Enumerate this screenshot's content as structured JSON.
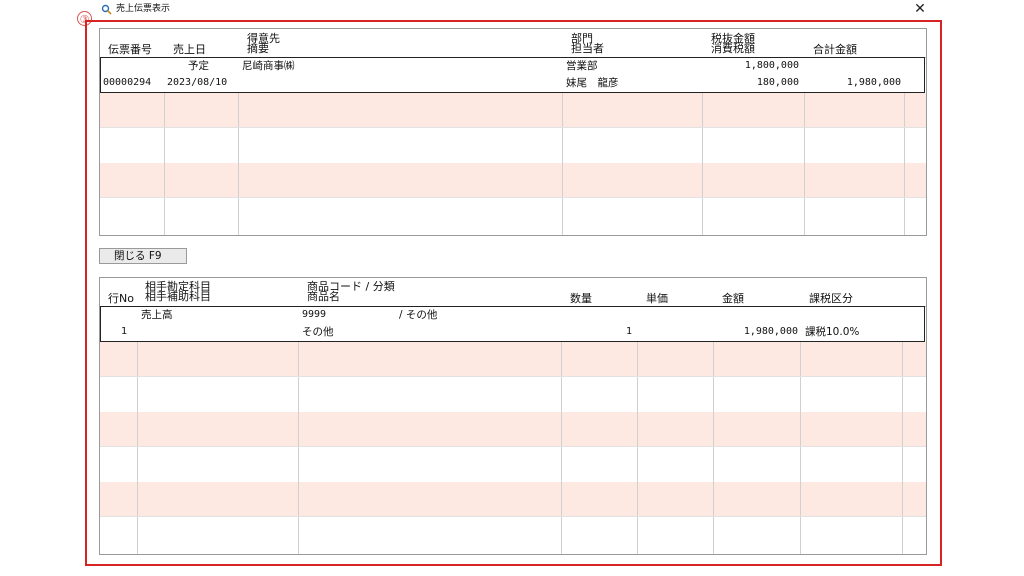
{
  "window": {
    "title": "売上伝票表示",
    "close_label": "✕"
  },
  "marker": "③",
  "upper": {
    "headers": {
      "slip_no": "伝票番号",
      "sales_date": "売上日",
      "customer": "得意先",
      "summary": "摘要",
      "department": "部門",
      "staff": "担当者",
      "amount_ex_tax": "税抜金額",
      "tax_amount": "消費税額",
      "total": "合計金額"
    },
    "row": {
      "status": "予定",
      "customer": "尼崎商事㈱",
      "department": "営業部",
      "amount_ex_tax": "1,800,000",
      "slip_no": "00000294",
      "sales_date": "2023/08/10",
      "staff": "妹尾　龍彦",
      "tax_amount": "180,000",
      "total": "1,980,000"
    }
  },
  "close_button": {
    "label": "閉じる F9"
  },
  "lower": {
    "headers": {
      "line_no": "行No",
      "account": "相手勘定科目",
      "sub_account": "相手補助科目",
      "product_code": "商品コード / 分類",
      "product_name": "商品名",
      "quantity": "数量",
      "unit_price": "単価",
      "amount": "金額",
      "tax_class": "課税区分"
    },
    "row": {
      "account": "売上高",
      "product_code": "9999",
      "category": "/ その他",
      "line_no": "1",
      "product_name": "その他",
      "quantity": "1",
      "amount": "1,980,000",
      "tax_class": "課税10.0%"
    }
  }
}
